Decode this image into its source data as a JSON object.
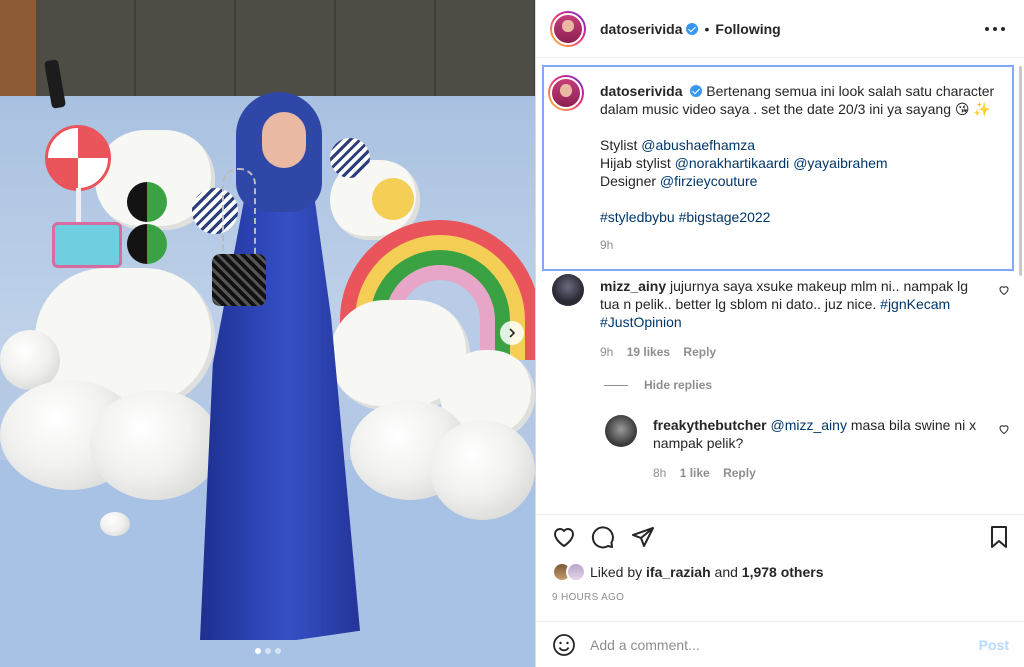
{
  "post": {
    "username": "datoserivida",
    "follow_status": "Following",
    "separator": "•",
    "caption": {
      "username": "datoserivida",
      "line1": "Bertenang semua ini look salah satu character",
      "line2": "dalam music video saya . set the date 20/3 ini ya sayang 😘 ✨",
      "stylist_label": "Stylist",
      "stylist_handle": "@abushaefhamza",
      "hijab_label": "Hijab stylist",
      "hijab_handle1": "@norakhartikaardi",
      "hijab_handle2": "@yayaibrahem",
      "designer_label": "Designer",
      "designer_handle": "@firzieycouture",
      "hashtag1": "#styledbybu",
      "hashtag2": "#bigstage2022",
      "time": "9h"
    },
    "comments": [
      {
        "username": "mizz_ainy",
        "line1": "jujurnya saya xsuke makeup mlm ni.. nampak lg",
        "line2": "tua n pelik.. better lg sblom ni dato.. juz nice.",
        "tag1": "#jgnKecam",
        "tag2": "#JustOpinion",
        "time": "9h",
        "likes": "19 likes",
        "reply": "Reply",
        "hide_replies": "Hide replies"
      },
      {
        "username": "freakythebutcher",
        "mention": "@mizz_ainy",
        "line1": "masa bila swine ni x",
        "line2": "nampak pelik?",
        "time": "8h",
        "likes": "1 like",
        "reply": "Reply"
      }
    ],
    "liked_by_prefix": "Liked by",
    "liked_by_user": "ifa_raziah",
    "liked_by_and": "and",
    "liked_by_others": "1,978 others",
    "time_ago": "9 HOURS AGO",
    "comment_placeholder": "Add a comment...",
    "post_button": "Post"
  },
  "colors": {
    "accent_blue": "#3897f0",
    "link": "#00376b",
    "post_disabled": "#b3dbff",
    "caption_highlight": "#7fa8f5"
  },
  "icons": [
    "more-icon",
    "verified-icon",
    "heart-icon",
    "comment-icon",
    "share-icon",
    "bookmark-icon",
    "emoji-icon",
    "chevron-right-icon"
  ],
  "carousel": {
    "total_images": 3,
    "current_index": 1
  }
}
